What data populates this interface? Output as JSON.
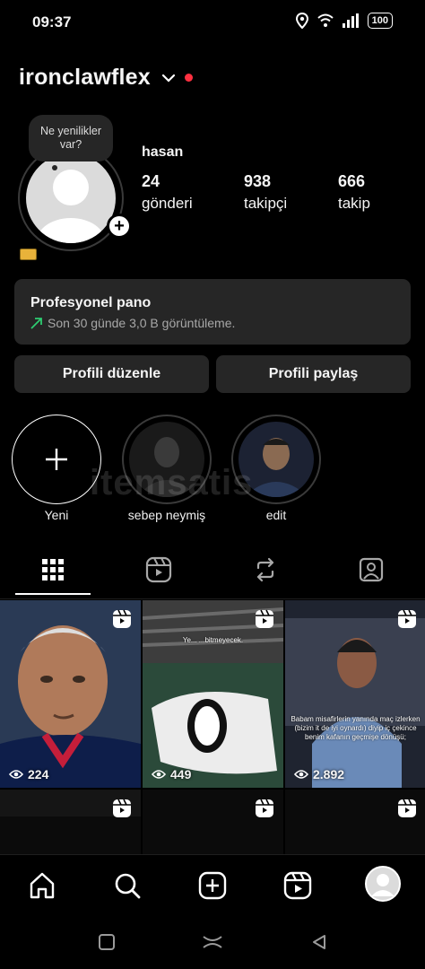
{
  "status": {
    "time": "09:37",
    "battery": "100"
  },
  "profile": {
    "username": "ironclawflex",
    "display_name": "hasan",
    "note": "Ne yenilikler var?",
    "stats": [
      {
        "value": "24",
        "label": "gönderi"
      },
      {
        "value": "938",
        "label": "takipçi"
      },
      {
        "value": "666",
        "label": "takip"
      }
    ]
  },
  "pro_panel": {
    "title": "Profesyonel pano",
    "subtitle": "Son 30 günde 3,0 B görüntüleme."
  },
  "buttons": {
    "edit": "Profili düzenle",
    "share": "Profili paylaş"
  },
  "highlights": [
    {
      "label": "Yeni"
    },
    {
      "label": "sebep neymiş"
    },
    {
      "label": "edit"
    }
  ],
  "watermark": "itemsatis",
  "posts": [
    {
      "views": "224",
      "caption": ""
    },
    {
      "views": "449",
      "caption": "Ye... ...bitmeyecek."
    },
    {
      "views": "2.892",
      "caption": "Babam misafirlerin yanında maç izlerken (bizim it de iyi oynardı) diyip iç çekince benim kafanın geçmişe dönüşü;"
    },
    {
      "views": "",
      "caption": ""
    },
    {
      "views": "",
      "caption": ""
    },
    {
      "views": "",
      "caption": ""
    }
  ],
  "colors": {
    "accent_red": "#ff3040",
    "panel": "#262626",
    "trend_green": "#2ecc71"
  }
}
